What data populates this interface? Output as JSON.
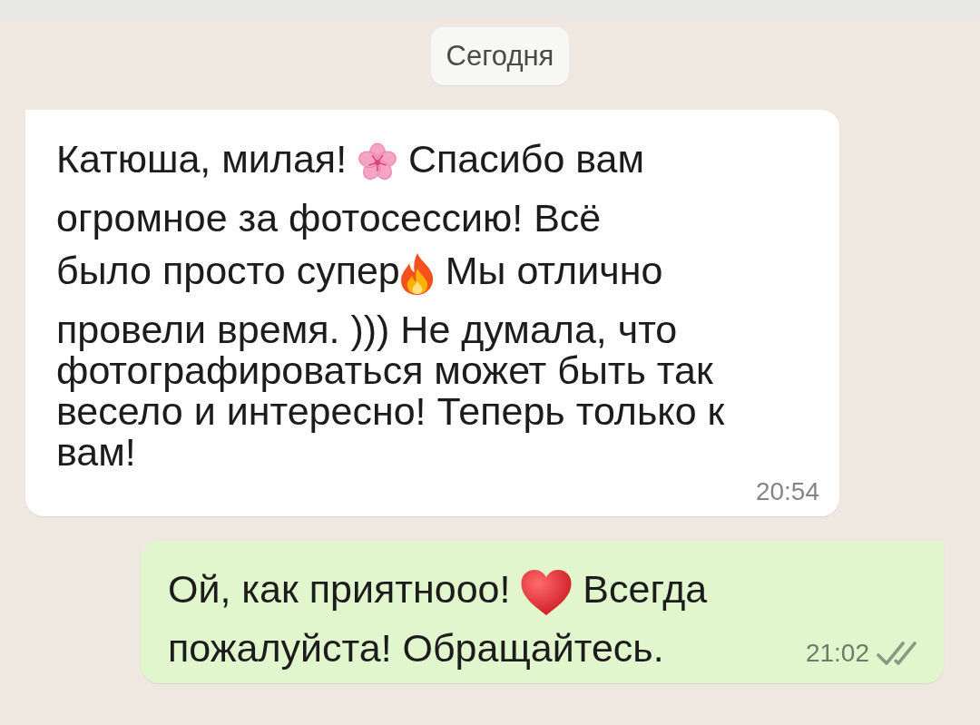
{
  "date_divider": "Сегодня",
  "messages": [
    {
      "kind": "incoming",
      "lines": [
        {
          "parts": [
            {
              "kind": "text",
              "text": "Катюша, милая! "
            },
            {
              "kind": "blossom"
            },
            {
              "kind": "text",
              "text": " Спасибо вам"
            }
          ]
        },
        {
          "parts": [
            {
              "kind": "text",
              "text": "огромное за фотосессию! Всё"
            }
          ]
        },
        {
          "parts": [
            {
              "kind": "text",
              "text": "было просто супер"
            },
            {
              "kind": "fire"
            },
            {
              "kind": "text",
              "text": " Мы отлично"
            }
          ]
        },
        {
          "parts": [
            {
              "kind": "text",
              "text": "провели время. ))) Не думала, что"
            }
          ]
        },
        {
          "parts": [
            {
              "kind": "text",
              "text": "фотографироваться может быть так"
            }
          ]
        },
        {
          "parts": [
            {
              "kind": "text",
              "text": "весело и интересно! Теперь только к"
            }
          ]
        },
        {
          "parts": [
            {
              "kind": "text",
              "text": "вам!"
            }
          ]
        }
      ],
      "time": "20:54"
    },
    {
      "kind": "outgoing",
      "lines": [
        {
          "parts": [
            {
              "kind": "text",
              "text": "Ой, как приятнооо! "
            },
            {
              "kind": "heart"
            },
            {
              "kind": "text",
              "text": " Всегда"
            }
          ]
        },
        {
          "parts": [
            {
              "kind": "text",
              "text": "пожалуйста! Обращайтесь."
            }
          ]
        }
      ],
      "time": "21:02",
      "read": false
    }
  ]
}
